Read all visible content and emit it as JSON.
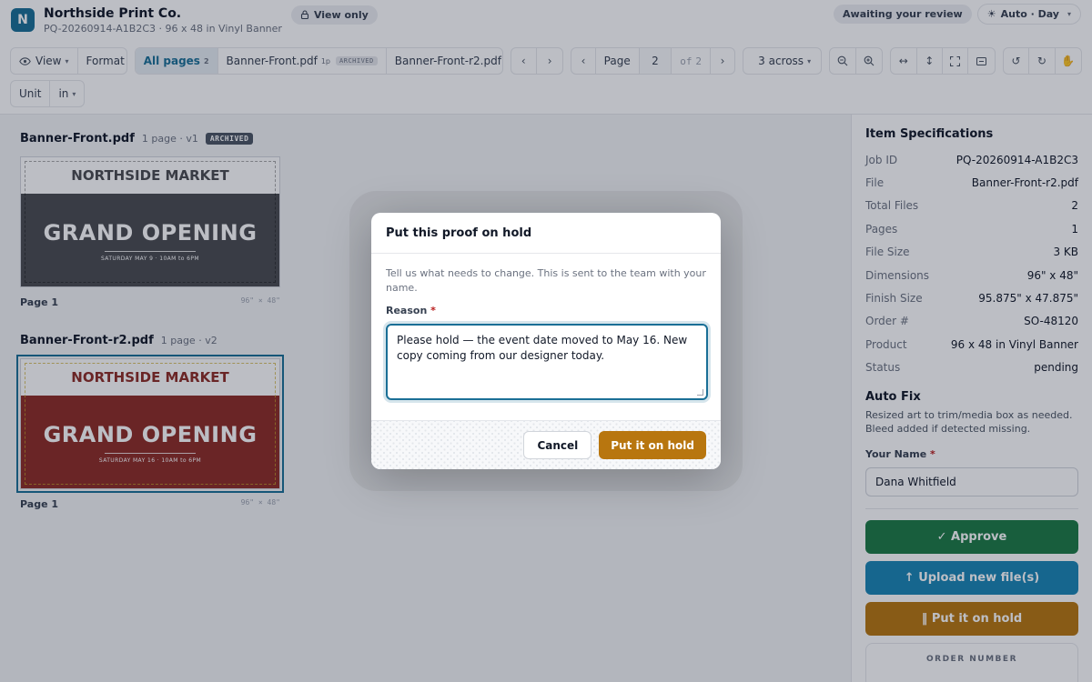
{
  "app": {
    "logo_letter": "N",
    "company": "Northside Print Co.",
    "subtitle": "PQ-20260914-A1B2C3 · 96 x 48 in Vinyl Banner",
    "view_only": "View only",
    "status_chip": "Awaiting your review",
    "theme": "Auto · Day"
  },
  "toolbar": {
    "view": "View",
    "format": "Format",
    "all_pages": "All pages",
    "all_pages_count": "2",
    "files": [
      {
        "name": "Banner-Front.pdf",
        "pages": "1p",
        "tag": "ARCHIVED"
      },
      {
        "name": "Banner-Front-r2.pdf",
        "pages": "1p",
        "tag": ""
      }
    ],
    "page_label": "Page",
    "page_current": "2",
    "page_of": "of",
    "page_total": "2",
    "across": "3 across",
    "unit_label": "Unit",
    "unit_value": "in"
  },
  "icons": {
    "view": "eye-icon",
    "lock": "lock-icon",
    "sun": "sun-icon",
    "zoom_out": "zoom-out-icon",
    "zoom_in": "zoom-in-icon",
    "fit_width": "fit-width-icon",
    "fit_height": "fit-height-icon",
    "fullscreen": "fullscreen-icon",
    "compare": "compare-icon",
    "undo": "undo-icon",
    "redo": "redo-icon",
    "pan": "hand-icon"
  },
  "proofs": [
    {
      "file": "Banner-Front.pdf",
      "meta": "1 page · v1",
      "badge": "ARCHIVED",
      "banner_top": "NORTHSIDE MARKET",
      "banner_big": "GRAND OPENING",
      "banner_small": "SATURDAY MAY 9  ·  10AM to 6PM",
      "page": "Page 1",
      "dims": "96\" × 48\""
    },
    {
      "file": "Banner-Front-r2.pdf",
      "meta": "1 page · v2",
      "badge": "",
      "banner_top": "NORTHSIDE MARKET",
      "banner_big": "GRAND OPENING",
      "banner_small": "SATURDAY MAY 16  ·  10AM to 6PM",
      "page": "Page 1",
      "dims": "96\" × 48\""
    }
  ],
  "specs": {
    "title": "Item Specifications",
    "rows": [
      {
        "k": "Job ID",
        "v": "PQ-20260914-A1B2C3"
      },
      {
        "k": "File",
        "v": "Banner-Front-r2.pdf"
      },
      {
        "k": "Total Files",
        "v": "2"
      },
      {
        "k": "Pages",
        "v": "1"
      },
      {
        "k": "File Size",
        "v": "3 KB"
      },
      {
        "k": "Dimensions",
        "v": "96\" x 48\""
      },
      {
        "k": "Finish Size",
        "v": "95.875\" x 47.875\""
      },
      {
        "k": "Order #",
        "v": "SO-48120"
      },
      {
        "k": "Product",
        "v": "96 x 48 in Vinyl Banner"
      },
      {
        "k": "Status",
        "v": "pending"
      }
    ]
  },
  "auto_fix": {
    "title": "Auto Fix",
    "line1": "Resized art to trim/media box as needed.",
    "line2": "Bleed added if detected missing."
  },
  "your_name": {
    "label": "Your Name",
    "value": "Dana Whitfield"
  },
  "actions": {
    "approve": "✓ Approve",
    "upload": "↑ Upload new file(s)",
    "hold": "‖ Put it on hold",
    "order_number": "ORDER NUMBER"
  },
  "modal": {
    "title": "Put this proof on hold",
    "description": "Tell us what needs to change. This is sent to the team with your name.",
    "reason_label": "Reason",
    "reason_value": "Please hold — the event date moved to May 16. New copy coming from our designer today.",
    "cancel": "Cancel",
    "confirm": "Put it on hold"
  },
  "colors": {
    "accent": "#1a6f96",
    "approve": "#1c7a45",
    "upload": "#1a86b4",
    "hold": "#b8760f",
    "banner_v1": "#4a4b4f",
    "banner_v2": "#8e2b25"
  }
}
